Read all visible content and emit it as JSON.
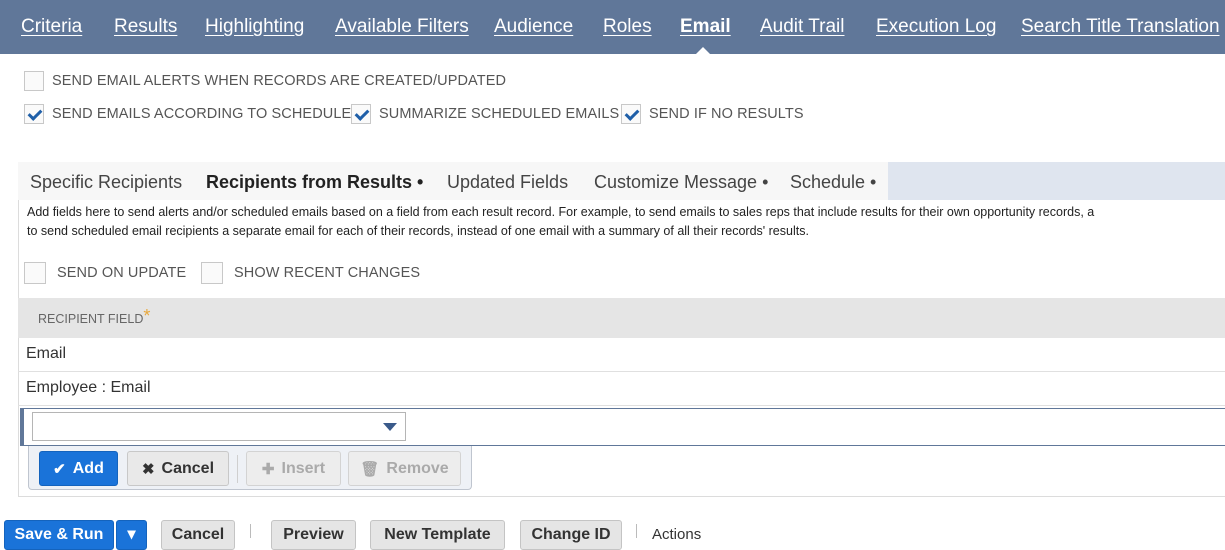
{
  "top_tabs": [
    {
      "label": "Criteria"
    },
    {
      "label": "Results"
    },
    {
      "label": "Highlighting"
    },
    {
      "label": "Available Filters"
    },
    {
      "label": "Audience"
    },
    {
      "label": "Roles"
    },
    {
      "label": "Email",
      "active": true
    },
    {
      "label": "Audit Trail"
    },
    {
      "label": "Execution Log"
    },
    {
      "label": "Search Title Translation"
    }
  ],
  "options": {
    "send_alerts": {
      "label": "SEND EMAIL ALERTS WHEN RECORDS ARE CREATED/UPDATED",
      "checked": false
    },
    "send_schedule": {
      "label": "SEND EMAILS ACCORDING TO SCHEDULE",
      "checked": true
    },
    "summarize": {
      "label": "SUMMARIZE SCHEDULED EMAILS",
      "checked": true
    },
    "send_if_none": {
      "label": "SEND IF NO RESULTS",
      "checked": true
    }
  },
  "sub_tabs": [
    {
      "label": "Specific Recipients"
    },
    {
      "label": "Recipients from Results •",
      "active": true
    },
    {
      "label": "Updated Fields"
    },
    {
      "label": "Customize Message •"
    },
    {
      "label": "Schedule •"
    }
  ],
  "help": {
    "line1": "Add fields here to send alerts and/or scheduled emails based on a field from each result record. For example, to send emails to sales reps that include results for their own opportunity records, a",
    "line2": "to send scheduled email recipients a separate email for each of their records, instead of one email with a summary of all their records' results."
  },
  "recipient_options": {
    "send_on_update": {
      "label": "SEND ON UPDATE",
      "checked": false
    },
    "show_recent": {
      "label": "SHOW RECENT CHANGES",
      "checked": false
    }
  },
  "table": {
    "header": "RECIPIENT FIELD",
    "required_mark": "*",
    "rows": [
      "Email",
      "Employee : Email"
    ],
    "select_value": ""
  },
  "row_actions": {
    "add": "Add",
    "cancel": "Cancel",
    "insert": "Insert",
    "remove": "Remove"
  },
  "footer": {
    "save_run": "Save & Run",
    "cancel": "Cancel",
    "preview": "Preview",
    "new_template": "New Template",
    "change_id": "Change ID",
    "actions": "Actions"
  },
  "colors": {
    "tab_bar": "#607799",
    "primary_button": "#1a73d9",
    "required": "#e8a83c"
  }
}
